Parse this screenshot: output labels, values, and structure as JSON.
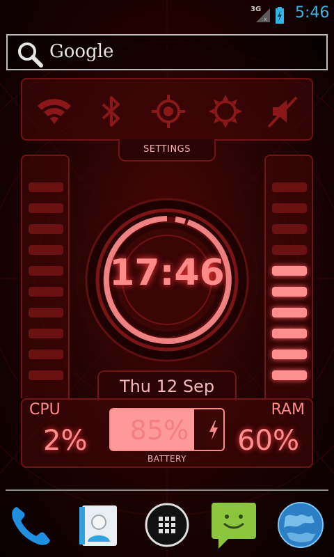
{
  "status_bar": {
    "network": "3G",
    "time": "5:46",
    "battery_charging": true
  },
  "search": {
    "label": "Google"
  },
  "toggles": [
    {
      "name": "wifi",
      "icon": "wifi-icon",
      "state": "on"
    },
    {
      "name": "bluetooth",
      "icon": "bluetooth-icon",
      "state": "off"
    },
    {
      "name": "gps",
      "icon": "gps-icon",
      "state": "off"
    },
    {
      "name": "brightness",
      "icon": "brightness-icon",
      "state": "off"
    },
    {
      "name": "sound",
      "icon": "sound-muted-icon",
      "state": "off"
    }
  ],
  "settings_label": "SETTINGS",
  "clock": {
    "time": "17:46"
  },
  "date": "Thu 12 Sep",
  "cpu": {
    "title": "CPU",
    "value": "2%",
    "meter_level": 0.0
  },
  "ram": {
    "title": "RAM",
    "value": "60%",
    "meter_level": 0.6
  },
  "battery": {
    "percent": "85%",
    "level": 0.85,
    "caption": "BATTERY"
  },
  "dock": [
    {
      "name": "phone",
      "icon": "phone-icon"
    },
    {
      "name": "contacts",
      "icon": "contacts-icon"
    },
    {
      "name": "app-drawer",
      "icon": "app-drawer-icon"
    },
    {
      "name": "messaging",
      "icon": "messaging-icon"
    },
    {
      "name": "browser",
      "icon": "globe-icon"
    }
  ],
  "colors": {
    "accent": "#ff8a8a",
    "status_time": "#33b5e5",
    "panel_border": "#6e1414"
  }
}
